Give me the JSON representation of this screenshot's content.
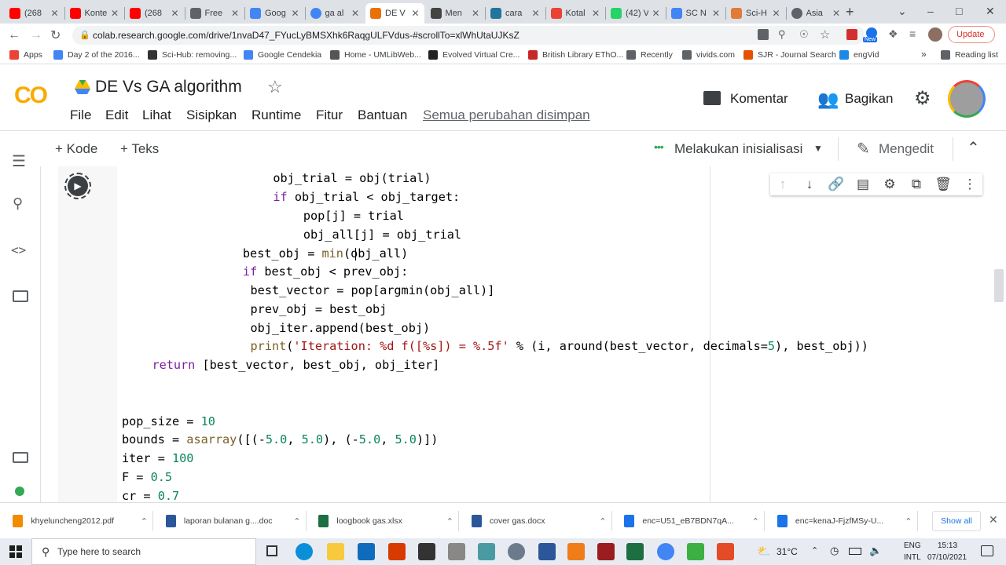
{
  "browser": {
    "tabs": [
      {
        "label": "(268",
        "favicon": "youtube"
      },
      {
        "label": "Konte",
        "favicon": "youtube"
      },
      {
        "label": "(268",
        "favicon": "youtube"
      },
      {
        "label": "Free",
        "favicon": "pen"
      },
      {
        "label": "Goog",
        "favicon": "docs"
      },
      {
        "label": "ga al",
        "favicon": "google"
      },
      {
        "label": "DE V",
        "favicon": "colab",
        "active": true
      },
      {
        "label": "Men",
        "favicon": "mendeley"
      },
      {
        "label": "cara",
        "favicon": "wordpress"
      },
      {
        "label": "Kotal",
        "favicon": "gmail"
      },
      {
        "label": "(42) V",
        "favicon": "whatsapp"
      },
      {
        "label": "SC N",
        "favicon": "scholar"
      },
      {
        "label": "Sci-H",
        "favicon": "scihub"
      },
      {
        "label": "Asia",
        "favicon": "globe"
      }
    ],
    "new_tab_label": "+",
    "url": "colab.research.google.com/drive/1nvaD47_FYucLyBMSXhk6RaqgULFVdus-#scrollTo=xlWhUtaUJKsZ",
    "update_label": "Update",
    "new_badge": "New",
    "bookmarks": [
      {
        "label": "Apps",
        "icon": "apps-grid-icon"
      },
      {
        "label": "Day 2 of the 2016...",
        "icon": "google-icon"
      },
      {
        "label": "Sci-Hub: removing...",
        "icon": "scihub-icon"
      },
      {
        "label": "Google Cendekia",
        "icon": "scholar-icon"
      },
      {
        "label": "Home - UMLibWeb...",
        "icon": "library-icon"
      },
      {
        "label": "Evolved Virtual Cre...",
        "icon": "page-icon"
      },
      {
        "label": "British Library EThO...",
        "icon": "bl-icon"
      },
      {
        "label": "Recently",
        "icon": "globe-icon"
      },
      {
        "label": "vivids.com",
        "icon": "globe-icon"
      },
      {
        "label": "SJR - Journal Search",
        "icon": "sjr-icon"
      },
      {
        "label": "engVid",
        "icon": "engvid-icon"
      }
    ],
    "bookmarks_overflow": "»",
    "reading_list": "Reading list"
  },
  "colab": {
    "logo": "CO",
    "title": "DE Vs GA algorithm",
    "menu": [
      "File",
      "Edit",
      "Lihat",
      "Sisipkan",
      "Runtime",
      "Fitur",
      "Bantuan"
    ],
    "save_status": "Semua perubahan disimpan",
    "comment_label": "Komentar",
    "share_label": "Bagikan",
    "add_code": "+ Kode",
    "add_text": "+ Teks",
    "runtime_status": "Melakukan inisialisasi",
    "edit_mode": "Mengedit"
  },
  "code_lines": [
    {
      "indent": 20,
      "parts": [
        [
          "obj_trial = obj(trial)",
          ""
        ]
      ]
    },
    {
      "indent": 20,
      "parts": [
        [
          "if",
          "kw"
        ],
        [
          " obj_trial < obj_target:",
          ""
        ]
      ]
    },
    {
      "indent": 24,
      "parts": [
        [
          "pop[j] = trial",
          ""
        ]
      ]
    },
    {
      "indent": 24,
      "parts": [
        [
          "obj_all[j] = obj_trial",
          ""
        ]
      ]
    },
    {
      "indent": 16,
      "parts": [
        [
          "best_obj = ",
          ""
        ],
        [
          "min",
          "fn"
        ],
        [
          "(obj_all)",
          ""
        ]
      ]
    },
    {
      "indent": 16,
      "parts": [
        [
          "if",
          "kw"
        ],
        [
          " best_obj < prev_obj:",
          ""
        ]
      ]
    },
    {
      "indent": 17,
      "parts": [
        [
          "best_vector = pop[argmin(obj_all)]",
          ""
        ]
      ]
    },
    {
      "indent": 17,
      "parts": [
        [
          "prev_obj = best_obj",
          ""
        ]
      ]
    },
    {
      "indent": 17,
      "parts": [
        [
          "obj_iter.append(best_obj)",
          ""
        ]
      ]
    },
    {
      "indent": 17,
      "parts": [
        [
          "print",
          "fn"
        ],
        [
          "(",
          ""
        ],
        [
          "'Iteration: %d f([%s]) = %.5f'",
          "str"
        ],
        [
          " % (i, around(best_vector, decimals=",
          ""
        ],
        [
          "5",
          "num"
        ],
        [
          "), best_obj))",
          ""
        ]
      ]
    },
    {
      "indent": 4,
      "parts": [
        [
          "return",
          "kw"
        ],
        [
          " [best_vector, best_obj, obj_iter]",
          ""
        ]
      ]
    },
    {
      "indent": 0,
      "parts": [
        [
          "",
          ""
        ]
      ]
    },
    {
      "indent": 0,
      "parts": [
        [
          "",
          ""
        ]
      ]
    },
    {
      "indent": 0,
      "parts": [
        [
          "pop_size = ",
          ""
        ],
        [
          "10",
          "num"
        ]
      ]
    },
    {
      "indent": 0,
      "parts": [
        [
          "bounds = ",
          ""
        ],
        [
          "asarray",
          "fn"
        ],
        [
          "([(-",
          ""
        ],
        [
          "5.0",
          "num"
        ],
        [
          ", ",
          ""
        ],
        [
          "5.0",
          "num"
        ],
        [
          "), (-",
          ""
        ],
        [
          "5.0",
          "num"
        ],
        [
          ", ",
          ""
        ],
        [
          "5.0",
          "num"
        ],
        [
          ")])",
          ""
        ]
      ]
    },
    {
      "indent": 0,
      "parts": [
        [
          "iter = ",
          ""
        ],
        [
          "100",
          "num"
        ]
      ]
    },
    {
      "indent": 0,
      "parts": [
        [
          "F = ",
          ""
        ],
        [
          "0.5",
          "num"
        ]
      ]
    },
    {
      "indent": 0,
      "parts": [
        [
          "cr = ",
          ""
        ],
        [
          "0.7",
          "num"
        ]
      ]
    }
  ],
  "downloads": [
    {
      "name": "khyeluncheng2012.pdf",
      "type": "pdf"
    },
    {
      "name": "laporan bulanan g....doc",
      "type": "word"
    },
    {
      "name": "loogbook gas.xlsx",
      "type": "excel"
    },
    {
      "name": "cover gas.docx",
      "type": "word"
    },
    {
      "name": "enc=U51_eB7BDN7qA...",
      "type": "generic"
    },
    {
      "name": "enc=kenaJ-FjzfMSy-U...",
      "type": "generic"
    }
  ],
  "show_all_label": "Show all",
  "taskbar": {
    "search_placeholder": "Type here to search",
    "temperature": "31°C",
    "lang": "ENG",
    "layout": "INTL",
    "time": "15:13",
    "date": "07/10/2021"
  },
  "colors": {
    "colab_orange": "#f9ab00",
    "colab_dark_orange": "#e8710a",
    "keyword": "#7b1fa2",
    "number": "#098658",
    "string": "#a31515",
    "function": "#795e26"
  }
}
